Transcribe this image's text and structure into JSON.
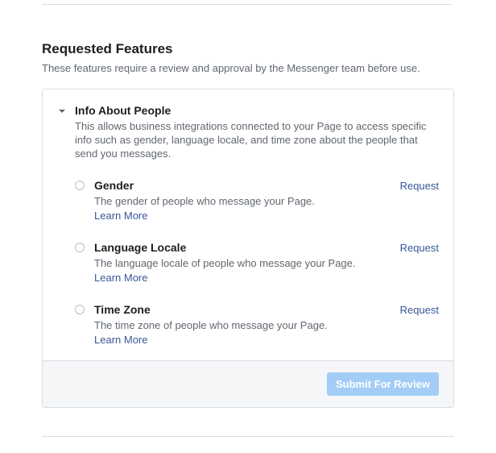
{
  "section": {
    "title": "Requested Features",
    "subtitle": "These features require a review and approval by the Messenger team before use."
  },
  "group": {
    "title": "Info About People",
    "desc": "This allows business integrations connected to your Page to access specific info such as gender, language locale, and time zone about the people that send you messages."
  },
  "features": [
    {
      "title": "Gender",
      "desc": "The gender of people who message your Page.",
      "learn": "Learn More",
      "action": "Request"
    },
    {
      "title": "Language Locale",
      "desc": "The language locale of people who message your Page.",
      "learn": "Learn More",
      "action": "Request"
    },
    {
      "title": "Time Zone",
      "desc": "The time zone of people who message your Page.",
      "learn": "Learn More",
      "action": "Request"
    }
  ],
  "footer": {
    "submit": "Submit For Review"
  }
}
